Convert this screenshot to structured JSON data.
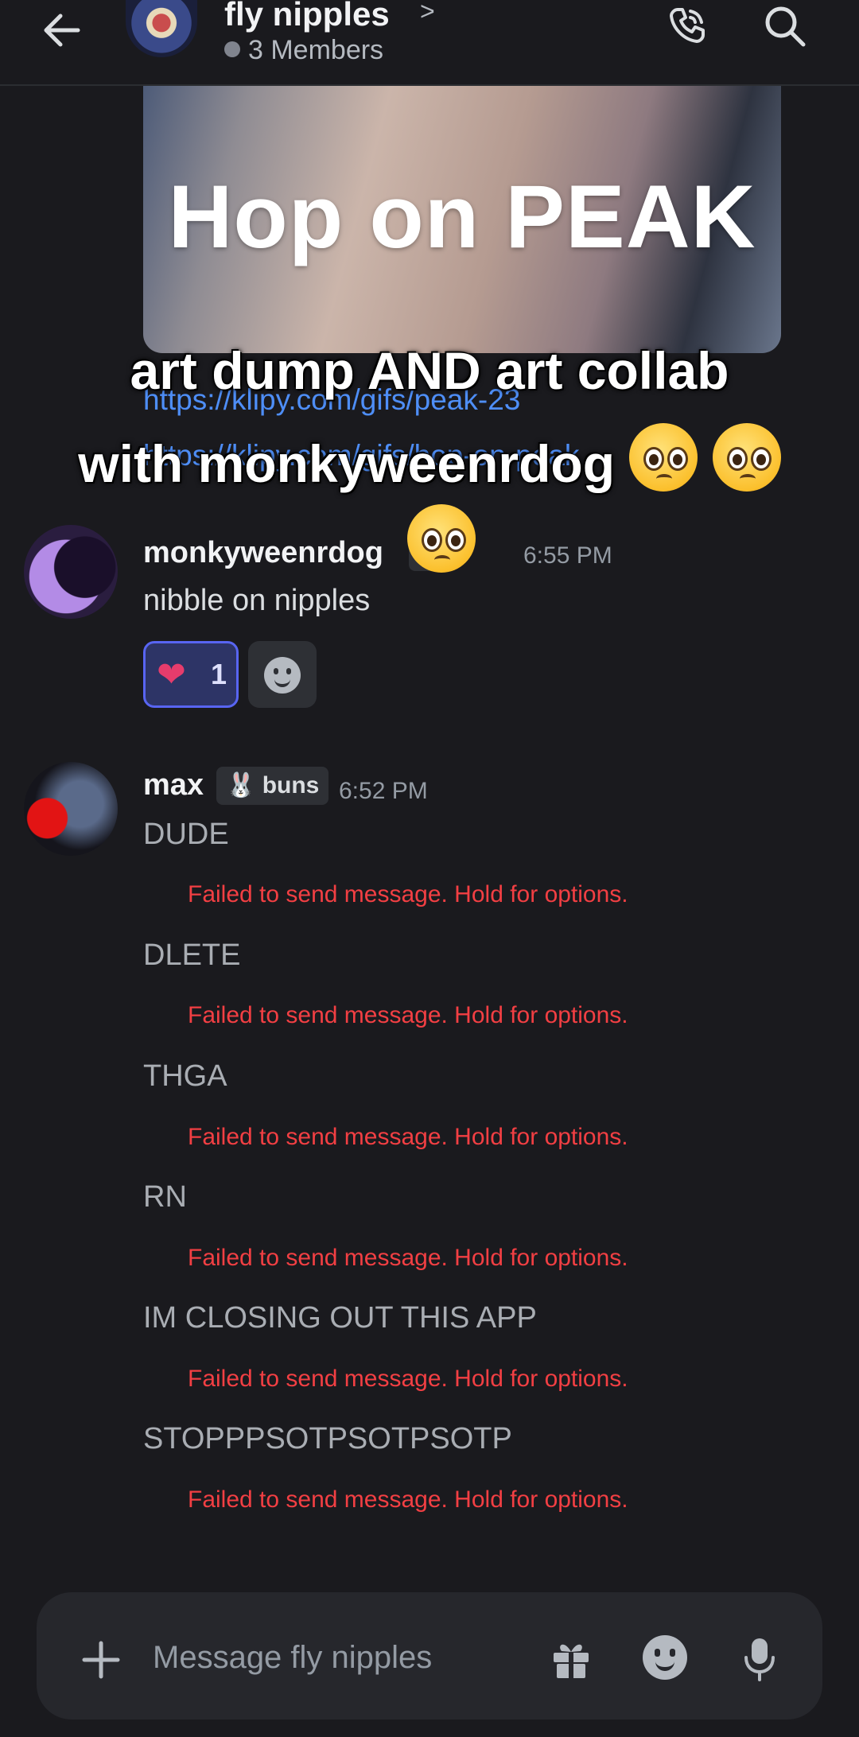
{
  "header": {
    "group_name": "fly nipples",
    "chevron": ">",
    "members": "3 Members",
    "icons": [
      "back-arrow-icon",
      "phone-call-icon",
      "search-icon"
    ]
  },
  "embed": {
    "gif_text": "Hop on PEAK",
    "link1": "https://klipy.com/gifs/peak-23",
    "link2": "https://klipy.com/gifs/hop-on-peak"
  },
  "overlay_caption": {
    "line1": "art dump AND art collab",
    "line2": "with monkyweenrdog"
  },
  "messages": [
    {
      "author": "monkyweenrdog",
      "tag": "X2",
      "time": "6:55 PM",
      "text": "nibble on nipples",
      "reactions": [
        {
          "emoji": "sparkling-heart",
          "count": "1"
        }
      ]
    },
    {
      "author": "max",
      "tag": "buns",
      "time": "6:52 PM",
      "lines": [
        {
          "text": "DUDE",
          "status": "Failed to send message. Hold for options."
        },
        {
          "text": "DLETE",
          "status": "Failed to send message. Hold for options."
        },
        {
          "text": "THGA",
          "status": "Failed to send message. Hold for options."
        },
        {
          "text": "RN",
          "status": "Failed to send message. Hold for options."
        },
        {
          "text": "IM CLOSING OUT THIS APP",
          "status": "Failed to send message. Hold for options."
        },
        {
          "text": "STOPPPSOTPSOTPSOTP",
          "status": "Failed to send message. Hold for options."
        }
      ]
    }
  ],
  "composer": {
    "placeholder": "Message fly nipples"
  },
  "colors": {
    "background": "#1a1a1e",
    "error": "#f23f43",
    "link": "#4e8ef7",
    "accent": "#5865f2"
  }
}
